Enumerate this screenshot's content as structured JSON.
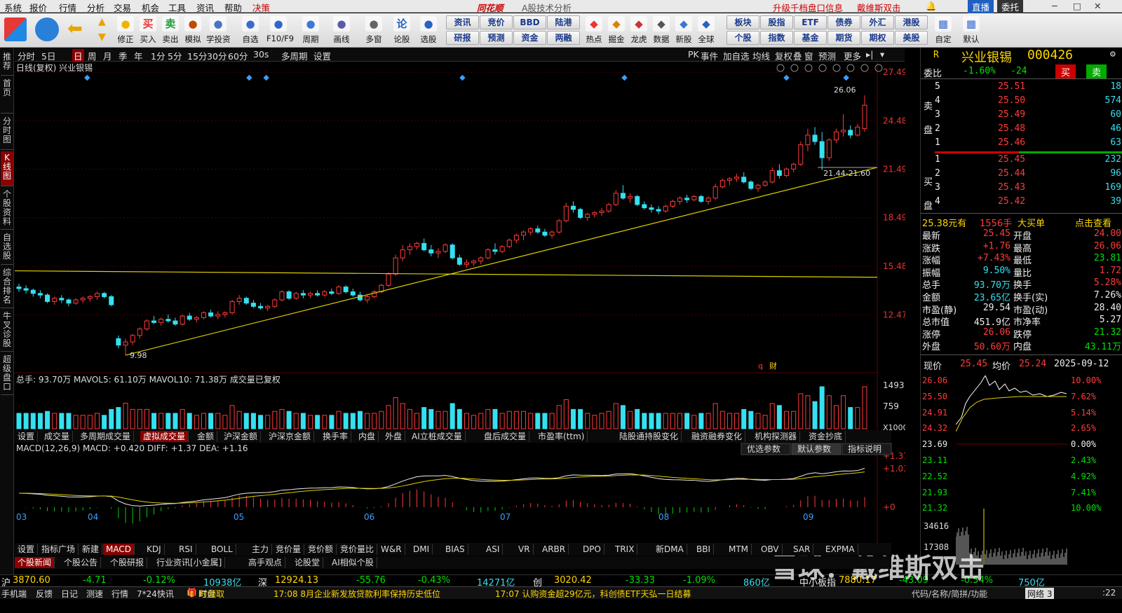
{
  "menu": {
    "items": [
      "系统",
      "报价",
      "行情",
      "分析",
      "交易",
      "机会",
      "工具",
      "资讯",
      "帮助",
      "决策"
    ],
    "brand": "同花顺",
    "subtitle": "A股技术分析",
    "promo1": "升级千档盘口信息",
    "promo2": "戴维斯双击",
    "btn_straight": "直播",
    "btn_trust": "委托"
  },
  "toolbar": {
    "big": [
      {
        "label": "修正",
        "icon": "refresh-icon"
      },
      {
        "label": "买入",
        "icon": "buy-icon",
        "ch": "买"
      },
      {
        "label": "卖出",
        "icon": "sell-icon",
        "ch": "卖"
      },
      {
        "label": "模拟",
        "icon": "hammer-icon"
      },
      {
        "label": "学投资",
        "icon": "graduation-icon"
      },
      {
        "label": "自选",
        "icon": "star-icon"
      },
      {
        "label": "F10/F9",
        "icon": "f10-icon"
      },
      {
        "label": "周期",
        "icon": "calendar-icon"
      },
      {
        "label": "画线",
        "icon": "pen-icon"
      },
      {
        "label": "多窗",
        "icon": "window-icon"
      },
      {
        "label": "论股",
        "icon": "discuss-icon",
        "ch": "论"
      },
      {
        "label": "选股",
        "icon": "filter-icon"
      }
    ],
    "grid_top": [
      "资讯",
      "竞价",
      "BBD",
      "陆港"
    ],
    "grid_bottom": [
      "研报",
      "预测",
      "资金",
      "两融"
    ],
    "big2": [
      {
        "label": "热点"
      },
      {
        "label": "掘金"
      },
      {
        "label": "龙虎"
      },
      {
        "label": "数据"
      },
      {
        "label": "新股"
      },
      {
        "label": "全球"
      }
    ],
    "grid2_top": [
      "板块",
      "股指",
      "ETF",
      "债券",
      "外汇",
      "港股"
    ],
    "grid2_bottom": [
      "个股",
      "指数",
      "基金",
      "期货",
      "期权",
      "美股"
    ],
    "right": [
      {
        "label": "自定"
      },
      {
        "label": "默认"
      }
    ]
  },
  "sidetabs": [
    "推荐",
    "首页",
    "分时图",
    "K线图",
    "个股资料",
    "自选股",
    "综合排名",
    "牛叉诊股",
    "超级盘口"
  ],
  "periods": [
    "分时",
    "5日",
    "日",
    "周",
    "月",
    "季",
    "年",
    "1分",
    "5分",
    "15分",
    "30分",
    "60分",
    "30s",
    "多周期",
    "设置"
  ],
  "toprightbtns": [
    "PK",
    "事件",
    "加自选",
    "均线",
    "复权",
    "叠",
    "窗",
    "预测",
    "更多"
  ],
  "chart_header": {
    "label": "日线(复权)",
    "name": "兴业银锡"
  },
  "chart_data": [
    {
      "type": "candlestick",
      "title": "日线(复权) 兴业银锡",
      "y_ticks": [
        27.49,
        24.48,
        21.49,
        18.49,
        15.48,
        12.47
      ],
      "ylim": [
        9.5,
        27.8
      ],
      "x_month_labels": [
        "03",
        "04",
        "05",
        "06",
        "07",
        "08",
        "09"
      ],
      "max_label": "26.06",
      "min_label": "9.98",
      "range_label": "21.44-21.60",
      "ohlc": [
        [
          14.2,
          14.4,
          13.9,
          14.1
        ],
        [
          14.1,
          14.3,
          13.8,
          14.0
        ],
        [
          14.0,
          14.1,
          13.6,
          13.8
        ],
        [
          13.8,
          14.0,
          13.5,
          13.7
        ],
        [
          13.7,
          13.8,
          13.2,
          13.3
        ],
        [
          13.3,
          13.6,
          13.1,
          13.5
        ],
        [
          13.5,
          13.7,
          13.2,
          13.4
        ],
        [
          13.4,
          13.5,
          13.0,
          13.2
        ],
        [
          13.2,
          13.5,
          13.1,
          13.4
        ],
        [
          13.4,
          13.6,
          13.2,
          13.5
        ],
        [
          13.5,
          13.7,
          13.3,
          13.6
        ],
        [
          13.6,
          13.9,
          13.4,
          13.8
        ],
        [
          13.8,
          13.9,
          13.5,
          13.6
        ],
        [
          13.6,
          13.7,
          13.0,
          13.1
        ],
        [
          11.0,
          11.2,
          10.4,
          10.6
        ],
        [
          10.6,
          11.0,
          9.98,
          10.8
        ],
        [
          10.8,
          11.3,
          10.6,
          11.2
        ],
        [
          11.2,
          11.7,
          11.0,
          11.6
        ],
        [
          11.6,
          12.2,
          11.5,
          12.1
        ],
        [
          12.1,
          12.4,
          11.9,
          12.0
        ],
        [
          12.0,
          12.3,
          11.8,
          12.2
        ],
        [
          12.2,
          12.5,
          12.0,
          12.1
        ],
        [
          12.1,
          12.3,
          11.8,
          11.9
        ],
        [
          11.9,
          12.5,
          11.8,
          12.4
        ],
        [
          12.4,
          12.6,
          12.1,
          12.2
        ],
        [
          12.2,
          12.4,
          12.0,
          12.3
        ],
        [
          12.3,
          12.7,
          12.2,
          12.6
        ],
        [
          12.6,
          12.8,
          12.3,
          12.4
        ],
        [
          12.4,
          12.7,
          12.2,
          12.5
        ],
        [
          12.5,
          12.7,
          12.3,
          12.6
        ],
        [
          12.6,
          13.4,
          12.5,
          13.3
        ],
        [
          13.3,
          13.7,
          13.1,
          13.5
        ],
        [
          13.5,
          13.6,
          13.1,
          13.2
        ],
        [
          13.2,
          13.4,
          12.9,
          13.0
        ],
        [
          13.0,
          13.2,
          12.8,
          12.9
        ],
        [
          12.9,
          13.1,
          12.7,
          13.0
        ],
        [
          13.0,
          13.5,
          12.9,
          13.4
        ],
        [
          13.4,
          14.0,
          13.3,
          13.9
        ],
        [
          13.9,
          14.0,
          13.4,
          13.5
        ],
        [
          13.5,
          13.9,
          13.4,
          13.8
        ],
        [
          13.8,
          14.0,
          13.5,
          13.7
        ],
        [
          13.7,
          13.9,
          13.5,
          13.8
        ],
        [
          13.8,
          14.0,
          13.6,
          13.7
        ],
        [
          13.7,
          14.0,
          13.6,
          13.9
        ],
        [
          13.9,
          14.1,
          13.7,
          13.8
        ],
        [
          13.8,
          14.3,
          13.7,
          14.2
        ],
        [
          14.2,
          14.3,
          13.8,
          13.9
        ],
        [
          13.9,
          14.1,
          13.6,
          13.7
        ],
        [
          13.7,
          13.9,
          13.3,
          13.4
        ],
        [
          13.4,
          13.7,
          13.2,
          13.6
        ],
        [
          13.6,
          14.0,
          13.5,
          13.9
        ],
        [
          13.9,
          14.4,
          13.8,
          14.3
        ],
        [
          14.3,
          15.1,
          14.2,
          15.0
        ],
        [
          15.0,
          16.2,
          14.9,
          16.0
        ],
        [
          16.0,
          16.8,
          15.8,
          16.5
        ],
        [
          16.5,
          16.9,
          16.2,
          16.7
        ],
        [
          16.7,
          17.0,
          16.5,
          16.9
        ],
        [
          16.9,
          17.2,
          16.4,
          16.5
        ],
        [
          16.5,
          16.8,
          16.1,
          16.3
        ],
        [
          16.3,
          16.6,
          16.0,
          16.4
        ],
        [
          16.4,
          16.9,
          16.3,
          16.8
        ],
        [
          16.8,
          16.9,
          15.9,
          16.0
        ],
        [
          16.0,
          16.2,
          15.5,
          15.6
        ],
        [
          15.6,
          15.9,
          15.4,
          15.7
        ],
        [
          15.7,
          15.9,
          15.5,
          15.8
        ],
        [
          15.8,
          16.1,
          15.6,
          16.0
        ],
        [
          16.0,
          16.6,
          15.9,
          16.5
        ],
        [
          16.5,
          16.9,
          16.2,
          16.4
        ],
        [
          16.4,
          16.8,
          16.3,
          16.7
        ],
        [
          16.7,
          17.2,
          16.6,
          17.1
        ],
        [
          17.1,
          17.5,
          16.9,
          17.4
        ],
        [
          17.4,
          17.7,
          17.1,
          17.6
        ],
        [
          17.6,
          17.9,
          17.4,
          17.8
        ],
        [
          17.8,
          18.0,
          17.5,
          17.6
        ],
        [
          17.6,
          17.8,
          17.3,
          17.4
        ],
        [
          17.4,
          17.7,
          17.2,
          17.6
        ],
        [
          17.6,
          18.4,
          17.5,
          18.3
        ],
        [
          18.3,
          19.4,
          18.2,
          19.2
        ],
        [
          19.2,
          19.5,
          18.8,
          19.0
        ],
        [
          19.0,
          19.1,
          18.4,
          18.5
        ],
        [
          18.5,
          18.8,
          18.3,
          18.7
        ],
        [
          18.7,
          18.9,
          18.5,
          18.8
        ],
        [
          18.8,
          19.1,
          18.6,
          18.9
        ],
        [
          18.9,
          19.4,
          18.8,
          19.3
        ],
        [
          19.3,
          20.2,
          19.2,
          20.0
        ],
        [
          20.0,
          20.5,
          19.6,
          19.7
        ],
        [
          19.7,
          20.0,
          19.4,
          19.8
        ],
        [
          19.8,
          19.9,
          19.2,
          19.3
        ],
        [
          19.3,
          19.5,
          19.0,
          19.1
        ],
        [
          19.1,
          19.3,
          18.8,
          19.0
        ],
        [
          19.0,
          19.2,
          18.7,
          18.9
        ],
        [
          18.9,
          19.3,
          18.8,
          19.2
        ],
        [
          19.2,
          19.6,
          19.1,
          19.5
        ],
        [
          19.5,
          19.8,
          19.3,
          19.7
        ],
        [
          19.7,
          19.9,
          19.4,
          19.6
        ],
        [
          19.6,
          19.9,
          19.5,
          19.8
        ],
        [
          19.8,
          19.9,
          19.4,
          19.5
        ],
        [
          19.5,
          19.8,
          19.3,
          19.7
        ],
        [
          19.7,
          20.6,
          19.6,
          20.4
        ],
        [
          20.4,
          20.9,
          20.3,
          20.8
        ],
        [
          20.8,
          21.0,
          20.5,
          20.9
        ],
        [
          20.9,
          21.2,
          20.7,
          21.0
        ],
        [
          21.0,
          21.3,
          20.6,
          20.7
        ],
        [
          20.7,
          20.8,
          20.2,
          20.3
        ],
        [
          20.3,
          20.6,
          20.1,
          20.5
        ],
        [
          20.5,
          20.8,
          20.4,
          20.7
        ],
        [
          20.7,
          21.6,
          20.6,
          21.4
        ],
        [
          21.4,
          21.8,
          20.9,
          21.1
        ],
        [
          21.1,
          21.6,
          21.0,
          21.5
        ],
        [
          21.5,
          21.9,
          21.3,
          21.8
        ],
        [
          21.8,
          23.2,
          21.7,
          23.0
        ],
        [
          23.0,
          24.0,
          22.6,
          23.6
        ],
        [
          23.6,
          24.1,
          23.0,
          23.2
        ],
        [
          23.2,
          23.8,
          21.44,
          22.2
        ],
        [
          22.2,
          23.4,
          22.0,
          23.3
        ],
        [
          23.3,
          24.0,
          23.1,
          23.8
        ],
        [
          23.8,
          24.9,
          23.5,
          23.9
        ],
        [
          23.9,
          24.2,
          23.4,
          23.6
        ],
        [
          23.6,
          24.3,
          23.5,
          24.1
        ],
        [
          24.0,
          26.06,
          23.81,
          25.45
        ]
      ]
    },
    {
      "type": "bar",
      "title": "成交量",
      "indicator": "总手",
      "total": "93.70万",
      "mavol5": "61.10万",
      "mavol10": "71.38万",
      "note": "成交量已复权",
      "y_ticks": [
        "1493",
        "759"
      ],
      "unit": "X1000"
    },
    {
      "type": "line",
      "title": "MACD(12,26,9)",
      "macd": "+0.420",
      "diff": "+1.37",
      "dea": "+1.16",
      "y_ticks": [
        "+1.37",
        "+1.03",
        "+0"
      ]
    }
  ],
  "indicator_tabs_top": [
    "设置",
    "成交量",
    "多周期成交量",
    "虚拟成交量",
    "金额",
    "沪深金额",
    "沪深京金额",
    "换手率",
    "内盘",
    "外盘",
    "AI立桩成交量",
    "盘后成交量",
    "市盈率(ttm)",
    "陆股通持股变化",
    "融资融券变化",
    "机构探测器",
    "资金抄底"
  ],
  "macd_btns": [
    "优选参数",
    "默认参数",
    "指标说明"
  ],
  "indicator_tabs_bottom": [
    "设置",
    "指标广场",
    "新建",
    "MACD",
    "KDJ",
    "RSI",
    "BOLL",
    "主力",
    "竞价量",
    "竞价额",
    "竞价量比",
    "W&R",
    "DMI",
    "BIAS",
    "ASI",
    "VR",
    "ARBR",
    "DPO",
    "TRIX",
    "新DMA",
    "BBI",
    "MTM",
    "OBV",
    "SAR",
    "EXPMA"
  ],
  "news_tabs": [
    "个股新闻",
    "个股公告",
    "个股研报",
    "行业资讯[小金属]",
    "高手观点",
    "论股堂",
    "AI相似个股"
  ],
  "quote": {
    "code": "000426",
    "name": "兴业银锡",
    "r": "R",
    "weibi_label": "委比",
    "weibi": "-1.60%",
    "weicha": "-24",
    "buy_btn": "买",
    "sell_btn": "卖",
    "sells": [
      {
        "lv": "5",
        "p": "25.51",
        "v": "18"
      },
      {
        "lv": "4",
        "p": "25.50",
        "v": "574"
      },
      {
        "lv": "3",
        "p": "25.49",
        "v": "60"
      },
      {
        "lv": "2",
        "p": "25.48",
        "v": "46"
      },
      {
        "lv": "1",
        "p": "25.46",
        "v": "63"
      }
    ],
    "buys": [
      {
        "lv": "1",
        "p": "25.45",
        "v": "232"
      },
      {
        "lv": "2",
        "p": "25.44",
        "v": "96"
      },
      {
        "lv": "3",
        "p": "25.43",
        "v": "169"
      },
      {
        "lv": "4",
        "p": "25.42",
        "v": "39"
      }
    ],
    "sell_label": "卖盘",
    "buy_label": "买盘",
    "bigorder": {
      "price": "25.38元有",
      "vol": "1556手",
      "tag": "大买单",
      "link": "点击查看"
    },
    "stats": [
      [
        "最新",
        "25.45",
        "开盘",
        "24.00"
      ],
      [
        "涨跌",
        "+1.76",
        "最高",
        "26.06"
      ],
      [
        "涨幅",
        "+7.43%",
        "最低",
        "23.81"
      ],
      [
        "振幅",
        "9.50%",
        "量比",
        "1.72"
      ],
      [
        "总手",
        "93.70万",
        "换手",
        "5.28%"
      ],
      [
        "金额",
        "23.65亿",
        "换手(实)",
        "7.26%"
      ],
      [
        "市盈(静)",
        "29.54",
        "市盈(动)",
        "28.40"
      ],
      [
        "总市值",
        "451.9亿",
        "市净率",
        "5.27"
      ],
      [
        "涨停",
        "26.06",
        "跌停",
        "21.32"
      ],
      [
        "外盘",
        "50.60万",
        "内盘",
        "43.11万"
      ]
    ],
    "mini": {
      "cur_label": "现价",
      "cur": "25.45",
      "avg_label": "均价",
      "avg": "25.24",
      "date": "2025-09-12",
      "left_ticks": [
        "26.06",
        "25.50",
        "24.91",
        "24.32",
        "23.69",
        "23.11",
        "22.52",
        "21.93",
        "21.32"
      ],
      "right_ticks": [
        "10.00%",
        "7.62%",
        "5.14%",
        "2.65%",
        "0.00%",
        "2.43%",
        "4.92%",
        "7.41%",
        "10.00%"
      ],
      "vol_ticks": [
        "34616",
        "17308"
      ]
    }
  },
  "indexbar": {
    "sh": "沪",
    "sh_v": "3870.60",
    "sh_c": "-4.71",
    "sh_p": "-0.12%",
    "sh_a": "10938亿",
    "sz": "深",
    "sz_v": "12924.13",
    "sz_c": "-55.76",
    "sz_p": "-0.43%",
    "sz_a": "14271亿",
    "cy": "创",
    "cy_v": "3020.42",
    "cy_c": "-33.33",
    "cy_p": "-1.09%",
    "cy_a": "860亿",
    "zx": "中小板指",
    "zx_v": "7880.17",
    "zx_c": "-43.09",
    "zx_p": "-0.54%",
    "zx_a": "750亿"
  },
  "status": {
    "items": [
      "手机端",
      "反馈",
      "日记",
      "测速",
      "行情",
      "7*24快讯",
      "盯盘"
    ],
    "gift": "时领取",
    "news1": "17:08 8月企业新发放贷款利率保持历史低位",
    "news2": "17:07 认购资金超29亿元，科创债ETF天弘一日结募",
    "right1": "代码/名称/简拼/功能",
    "net": "网络 3",
    "time": ":22"
  },
  "watermark": "雪球：戴维斯双击"
}
